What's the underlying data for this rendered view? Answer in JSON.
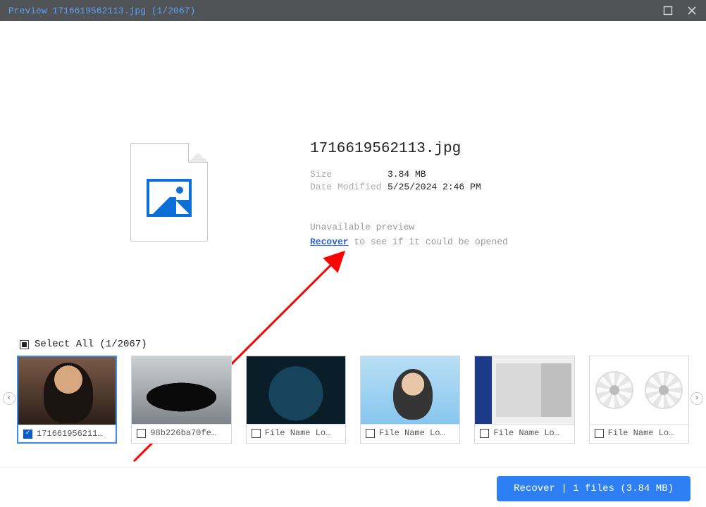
{
  "titlebar": {
    "title": "Preview 1716619562113.jpg (1/2067)"
  },
  "preview": {
    "filename": "1716619562113.jpg",
    "size_label": "Size",
    "size_value": "3.84 MB",
    "date_label": "Date Modified",
    "date_value": "5/25/2024 2:46 PM",
    "unavailable": "Unavailable preview",
    "recover_link": "Recover",
    "recover_rest": " to see if it could be opened"
  },
  "selectall": {
    "label": "Select All (1/2067)"
  },
  "thumbs": [
    {
      "label": "171661956211…",
      "checked": true,
      "selected": true
    },
    {
      "label": "98b226ba70fe…",
      "checked": false,
      "selected": false
    },
    {
      "label": "File Name Lo…",
      "checked": false,
      "selected": false
    },
    {
      "label": "File Name Lo…",
      "checked": false,
      "selected": false
    },
    {
      "label": "File Name Lo…",
      "checked": false,
      "selected": false
    },
    {
      "label": "File Name Lo…",
      "checked": false,
      "selected": false
    }
  ],
  "footer": {
    "button": "Recover | 1 files (3.84 MB)"
  }
}
